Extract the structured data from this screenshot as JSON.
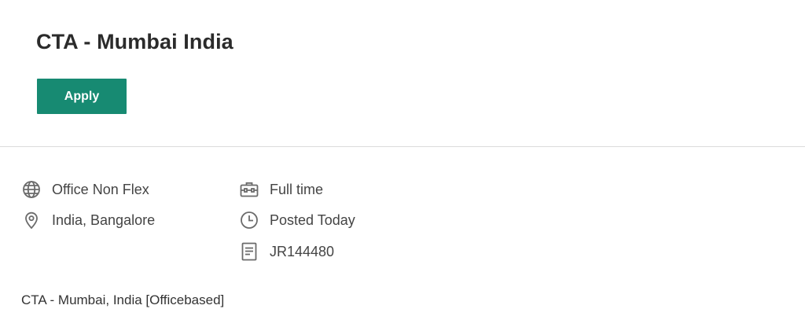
{
  "job": {
    "title": "CTA - Mumbai India",
    "apply_label": "Apply"
  },
  "details": {
    "work_type": {
      "label": "Office Non Flex",
      "icon": "globe-icon"
    },
    "location": {
      "label": "India, Bangalore",
      "icon": "location-pin-icon"
    },
    "employment_type": {
      "label": "Full time",
      "icon": "briefcase-icon"
    },
    "posted": {
      "label": "Posted Today",
      "icon": "clock-icon"
    },
    "requisition_id": {
      "label": "JR144480",
      "icon": "document-icon"
    }
  },
  "description": {
    "first_line": "CTA - Mumbai, India [Officebased]"
  },
  "colors": {
    "accent": "#178a72",
    "icon": "#6b6b6b",
    "divider": "#dcdcdc"
  }
}
